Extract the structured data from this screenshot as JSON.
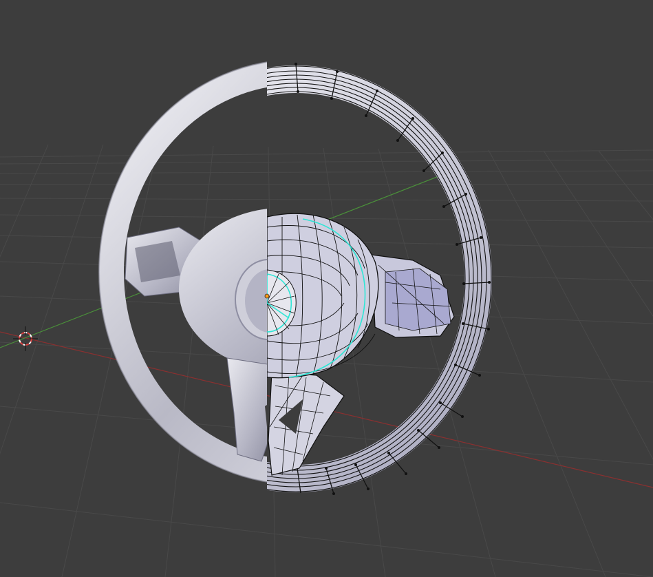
{
  "viewport": {
    "background": "#3d3d3d",
    "grid_color": "#4a4a4a",
    "x_axis_color": "#8a2f2f",
    "y_axis_color": "#4b8f3a",
    "selection_edge_color": "#2ee6d6"
  },
  "scene": {
    "object": "steering-wheel-mesh",
    "mode": "edit-mode-wireframe-half",
    "cursor_icon": "3d-cursor-icon",
    "origin_icon": "object-origin-icon"
  }
}
